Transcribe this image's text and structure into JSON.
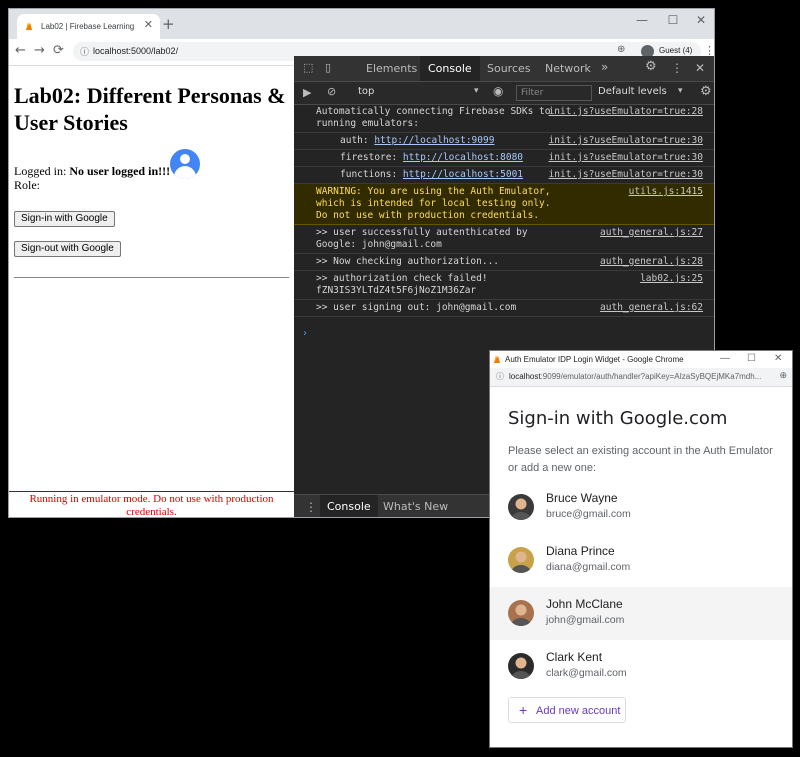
{
  "browser": {
    "tab_title": "Lab02 | Firebase Learning",
    "tab_close": "✕",
    "new_tab": "+",
    "url": "localhost:5000/lab02/",
    "profile": "Guest (4)",
    "nav": {
      "back": "←",
      "forward": "→",
      "reload": "⟳"
    },
    "controls": {
      "min": "—",
      "max": "☐",
      "close": "✕"
    }
  },
  "page": {
    "title": "Lab02: Different Personas & User Stories",
    "login_label": "Logged in:",
    "login_value": "No user logged in!!!",
    "role_label": "Role:",
    "signin_button": "Sign-in with Google",
    "signout_button": "Sign-out with Google",
    "emulator_banner": "Running in emulator mode. Do not use with production credentials."
  },
  "devtools": {
    "tabs": [
      "Elements",
      "Console",
      "Sources",
      "Network"
    ],
    "active_tab": "Console",
    "more": "»",
    "context": "top",
    "filter_placeholder": "Filter",
    "levels": "Default levels",
    "console": [
      {
        "text": "Automatically connecting Firebase SDKs to running emulators:",
        "source": "init.js?useEmulator=true:28"
      },
      {
        "text": "auth: ",
        "link": "http://localhost:9099",
        "source": "init.js?useEmulator=true:30",
        "indent": true
      },
      {
        "text": "firestore: ",
        "link": "http://localhost:8080",
        "source": "init.js?useEmulator=true:30",
        "indent": true
      },
      {
        "text": "functions: ",
        "link": "http://localhost:5001",
        "source": "init.js?useEmulator=true:30",
        "indent": true
      },
      {
        "text": "WARNING: You are using the Auth Emulator, which is intended for local testing only.  Do not use with production credentials.",
        "source": "utils.js:1415",
        "warn": true
      },
      {
        "text": ">> user successfully autenthicated by Google: john@gmail.com",
        "source": "auth_general.js:27"
      },
      {
        "text": ">> Now checking authorization...",
        "source": "auth_general.js:28"
      },
      {
        "text": ">> authorization check failed! fZN3IS3YLTdZ4t5F6jNoZ1M36Zar",
        "source": "lab02.js:25"
      },
      {
        "text": ">> user signing out: john@gmail.com",
        "source": "auth_general.js:62"
      }
    ],
    "prompt": "›",
    "bottom_tabs": [
      "Console",
      "What's New"
    ]
  },
  "popup": {
    "title": "Auth Emulator IDP Login Widget - Google Chrome",
    "url_host": "localhost",
    "url_rest": ":9099/emulator/auth/handler?apiKey=AIzaSyBQEjMKa7mdh...",
    "heading": "Sign-in with Google.com",
    "description": "Please select an existing account in the Auth Emulator or add a new one:",
    "accounts": [
      {
        "name": "Bruce Wayne",
        "email": "bruce@gmail.com",
        "color": "#3a3a3a"
      },
      {
        "name": "Diana Prince",
        "email": "diana@gmail.com",
        "color": "#c8a24a"
      },
      {
        "name": "John McClane",
        "email": "john@gmail.com",
        "color": "#a8724f",
        "selected": true
      },
      {
        "name": "Clark Kent",
        "email": "clark@gmail.com",
        "color": "#2b2b2b"
      }
    ],
    "add_account": "Add new account"
  }
}
